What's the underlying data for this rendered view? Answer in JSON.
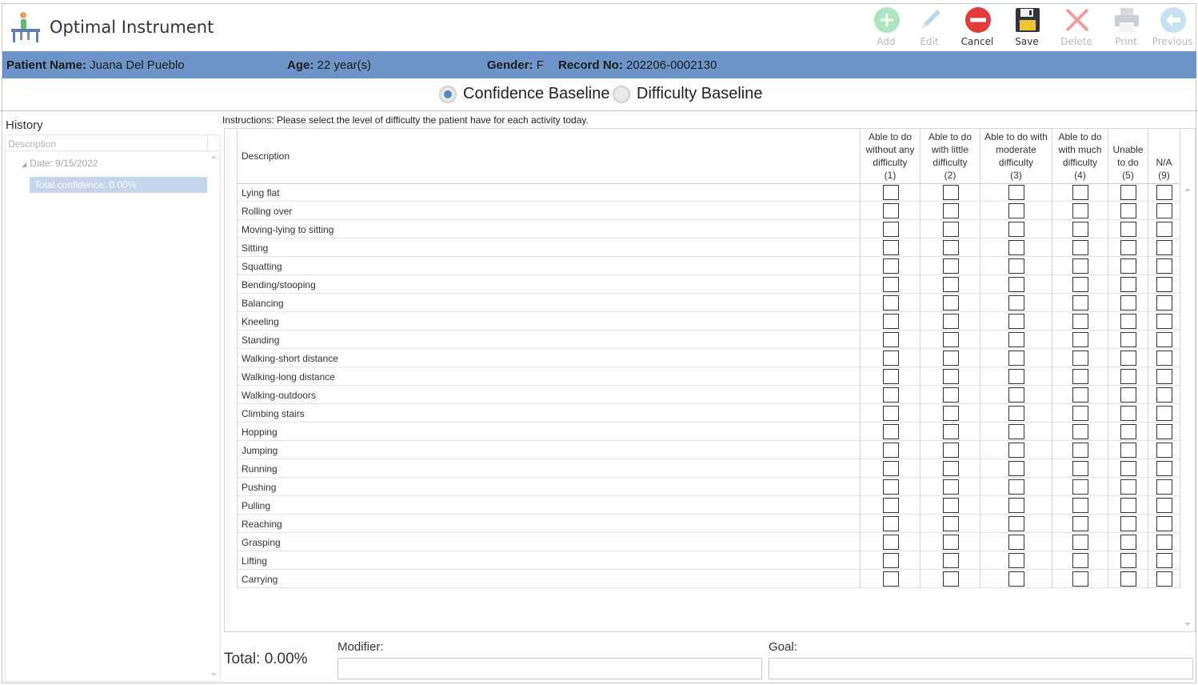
{
  "app": {
    "title": "Optimal Instrument"
  },
  "toolbar": {
    "add": "Add",
    "edit": "Edit",
    "cancel": "Cancel",
    "save": "Save",
    "delete": "Delete",
    "print": "Print",
    "previous": "Previous"
  },
  "patient": {
    "name_label": "Patient Name:",
    "name": "Juana Del Pueblo",
    "age_label": "Age:",
    "age": "22 year(s)",
    "gender_label": "Gender:",
    "gender": "F",
    "record_label": "Record No:",
    "record": "202206-0002130"
  },
  "mode": {
    "confidence": "Confidence Baseline",
    "difficulty": "Difficulty Baseline",
    "selected": "confidence"
  },
  "history": {
    "title": "History",
    "column": "Description",
    "node": "Date: 9/15/2022",
    "selected_item": "Total confidence: 0.00%"
  },
  "instructions": "Instructions: Please select the level of difficulty the patient have for each activity today.",
  "grid": {
    "desc_header": "Description",
    "columns": [
      [
        "Able to do",
        "without any",
        "difficulty",
        "(1)"
      ],
      [
        "Able to do",
        "with little",
        "difficulty",
        "(2)"
      ],
      [
        "Able to do with",
        "moderate",
        "difficulty",
        "(3)"
      ],
      [
        "Able to do",
        "with much",
        "difficulty",
        "(4)"
      ],
      [
        "Unable",
        "to do",
        "(5)"
      ],
      [
        "N/A",
        "(9)"
      ]
    ],
    "activities": [
      "Lying flat",
      "Rolling over",
      "Moving-lying to sitting",
      "Sitting",
      "Squatting",
      "Bending/stooping",
      "Balancing",
      "Kneeling",
      "Standing",
      "Walking-short distance",
      "Walking-long distance",
      "Walking-outdoors",
      "Climbing stairs",
      "Hopping",
      "Jumping",
      "Running",
      "Pushing",
      "Pulling",
      "Reaching",
      "Grasping",
      "Lifting",
      "Carrying"
    ]
  },
  "footer": {
    "total": "Total: 0.00%",
    "modifier_label": "Modifier:",
    "modifier_value": "",
    "goal_label": "Goal:",
    "goal_value": ""
  },
  "colors": {
    "banner": "#6d94c8",
    "selection": "#c5d6ec",
    "add_icon": "#6fce8e",
    "edit_icon": "#7fb6e6",
    "cancel_icon": "#e23b3b",
    "delete_icon": "#f08a8a"
  }
}
